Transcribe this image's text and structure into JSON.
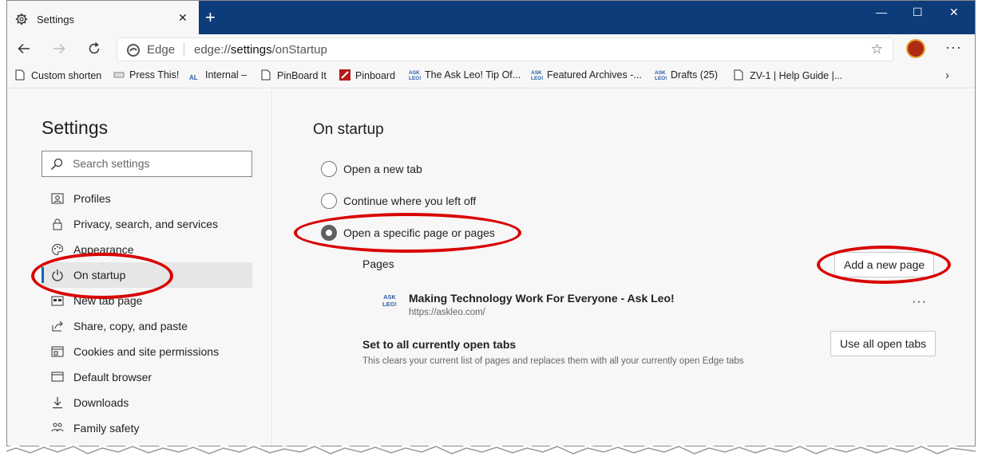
{
  "window": {
    "tab_title": "Settings",
    "tab_close": "✕",
    "new_tab": "+",
    "minimize": "—",
    "maximize": "☐",
    "close": "✕"
  },
  "address_bar": {
    "brand": "Edge",
    "url_scheme": "edge://",
    "url_host": "settings",
    "url_path": "/onStartup",
    "favorite_icon": "star-icon"
  },
  "favorites": [
    {
      "label": "Custom shorten",
      "icon": "page-icon"
    },
    {
      "label": "Press This!",
      "icon": "press-icon"
    },
    {
      "label": "Internal –",
      "icon": "albiz-icon"
    },
    {
      "label": "PinBoard It",
      "icon": "page-icon"
    },
    {
      "label": "Pinboard",
      "icon": "pinboard-icon"
    },
    {
      "label": "The Ask Leo! Tip Of...",
      "icon": "askleo-icon"
    },
    {
      "label": "Featured Archives -...",
      "icon": "askleo-icon"
    },
    {
      "label": "Drafts (25)",
      "icon": "askleo-icon"
    },
    {
      "label": "ZV-1 | Help Guide |...",
      "icon": "page-icon"
    }
  ],
  "sidebar": {
    "title": "Settings",
    "search_placeholder": "Search settings",
    "items": [
      {
        "label": "Profiles",
        "icon": "profile-icon"
      },
      {
        "label": "Privacy, search, and services",
        "icon": "lock-icon"
      },
      {
        "label": "Appearance",
        "icon": "palette-icon"
      },
      {
        "label": "On startup",
        "icon": "power-icon"
      },
      {
        "label": "New tab page",
        "icon": "newtab-icon"
      },
      {
        "label": "Share, copy, and paste",
        "icon": "share-icon"
      },
      {
        "label": "Cookies and site permissions",
        "icon": "cookies-icon"
      },
      {
        "label": "Default browser",
        "icon": "browser-icon"
      },
      {
        "label": "Downloads",
        "icon": "download-icon"
      },
      {
        "label": "Family safety",
        "icon": "family-icon"
      }
    ]
  },
  "main": {
    "heading": "On startup",
    "options": [
      {
        "label": "Open a new tab",
        "checked": false
      },
      {
        "label": "Continue where you left off",
        "checked": false
      },
      {
        "label": "Open a specific page or pages",
        "checked": true
      }
    ],
    "pages_label": "Pages",
    "add_page_button": "Add a new page",
    "page_entry": {
      "icon_text": "ASK LEO!",
      "title": "Making Technology Work For Everyone - Ask Leo!",
      "url": "https://askleo.com/",
      "more": "···"
    },
    "open_tabs_title": "Set to all currently open tabs",
    "open_tabs_desc": "This clears your current list of pages and replaces them with all your currently open Edge tabs",
    "use_open_tabs_button": "Use all open tabs"
  },
  "annotation_color": "#d90000"
}
